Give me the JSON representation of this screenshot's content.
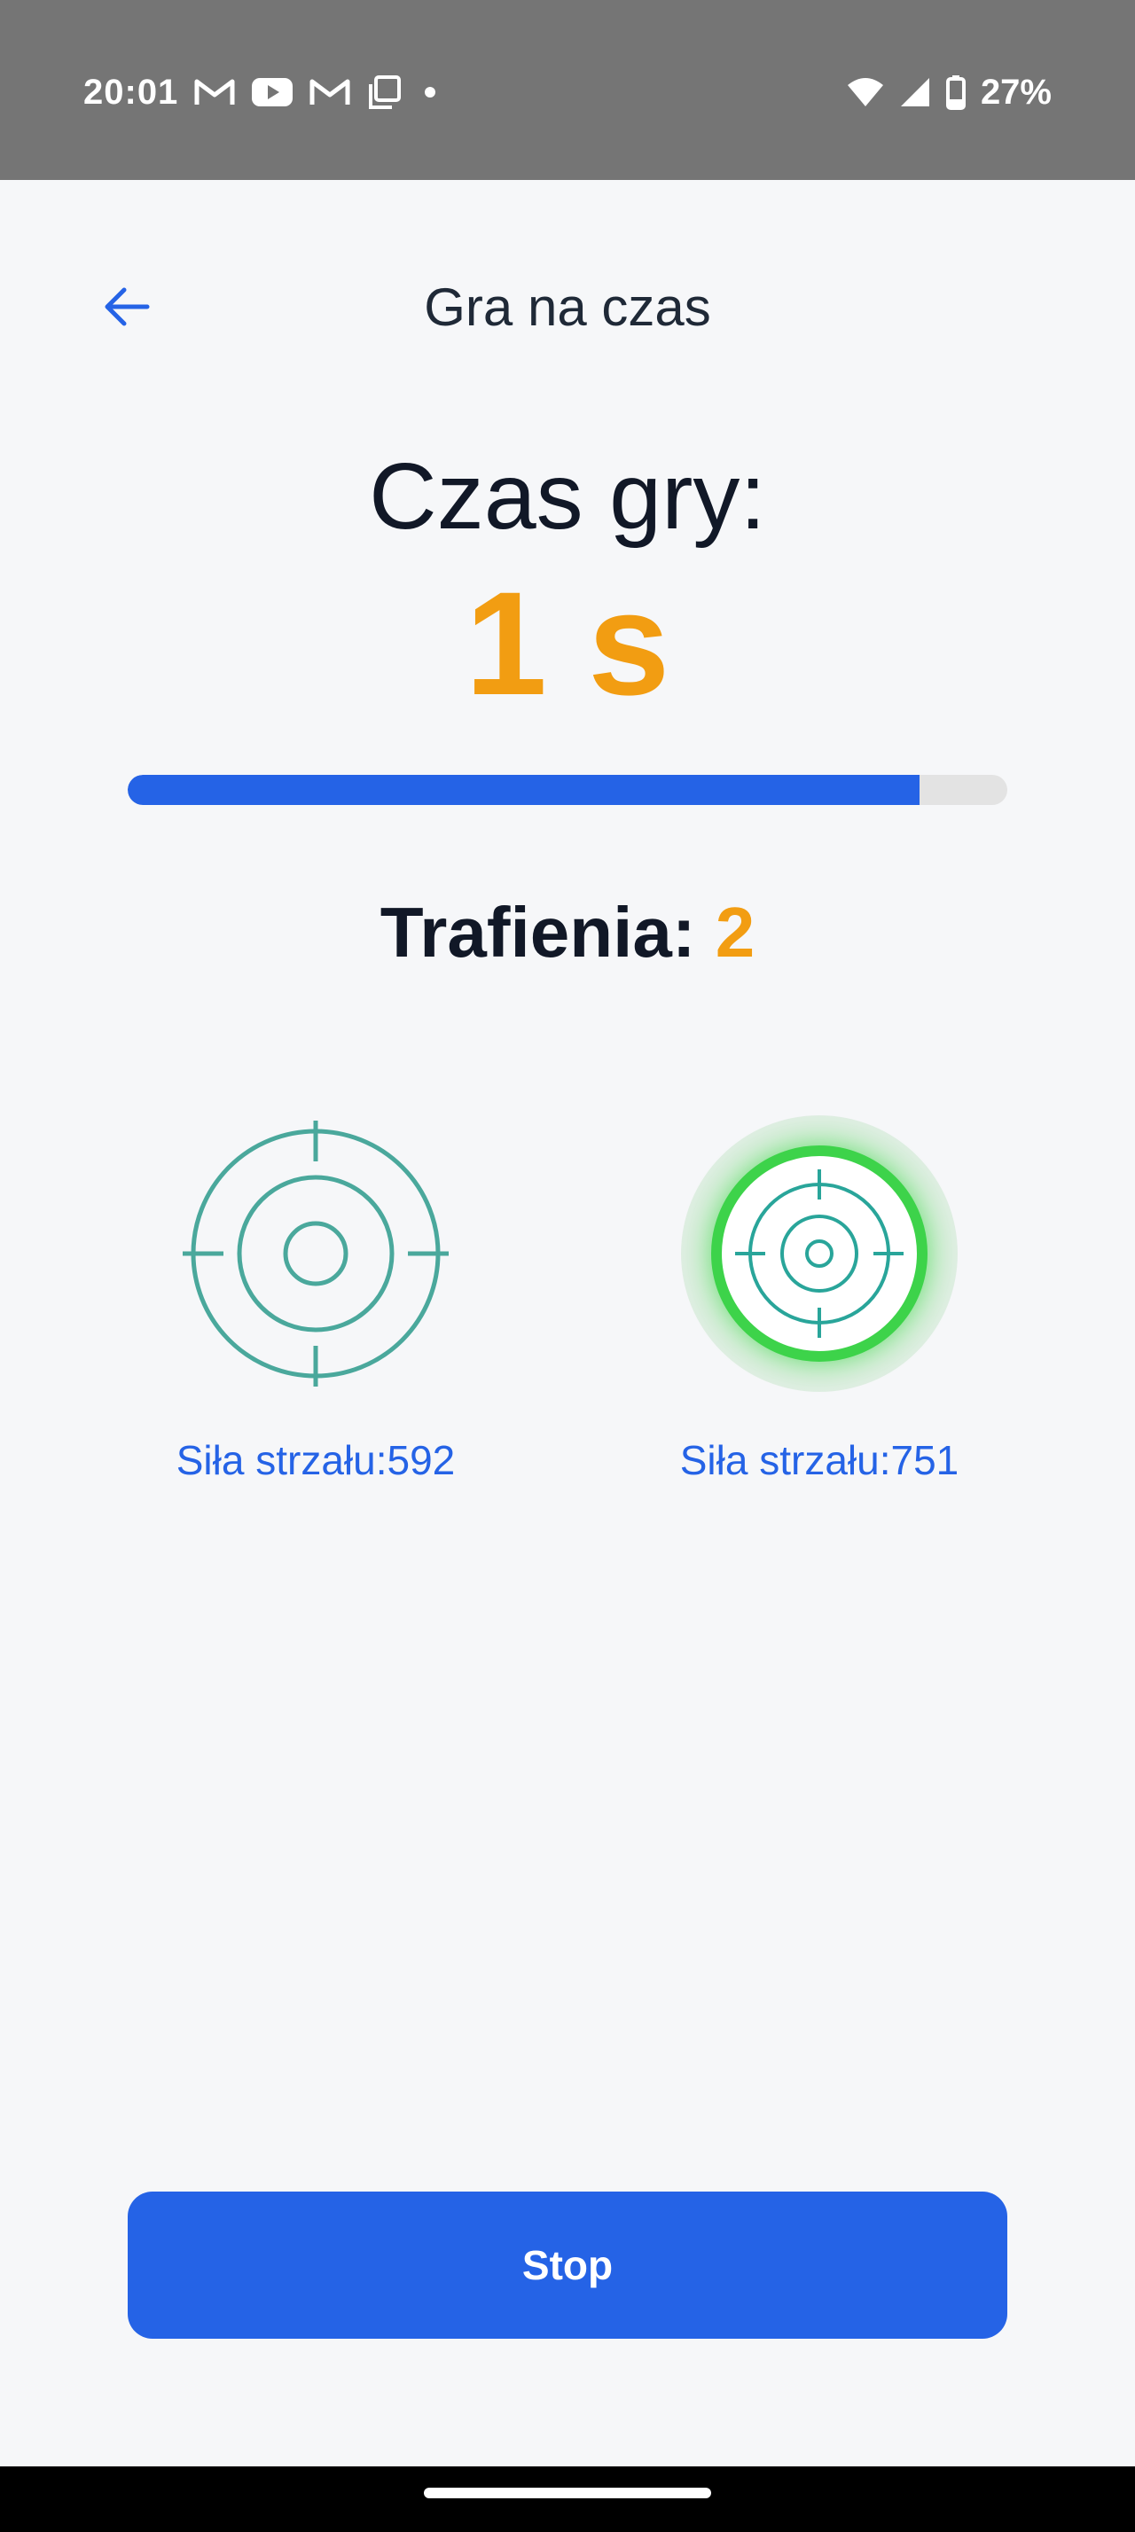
{
  "status_bar": {
    "time": "20:01",
    "battery_percent": "27%",
    "icons": [
      "gmail-icon",
      "youtube-icon",
      "gmail-icon",
      "copy-icon",
      "dot-icon",
      "wifi-icon",
      "signal-icon",
      "battery-icon"
    ]
  },
  "header": {
    "title": "Gra na czas",
    "back_icon": "arrow-left-icon"
  },
  "timer": {
    "label": "Czas gry:",
    "value": "1 s",
    "progress_fraction": 0.9
  },
  "hits": {
    "label": "Trafienia:",
    "count": "2"
  },
  "targets": [
    {
      "icon": "crosshair-icon",
      "shot_power_label": "Siła strzału:592",
      "active": false
    },
    {
      "icon": "crosshair-icon",
      "shot_power_label": "Siła strzału:751",
      "active": true
    }
  ],
  "actions": {
    "stop_label": "Stop"
  },
  "colors": {
    "accent_blue": "#2563e6",
    "accent_orange": "#f29d12",
    "target_teal": "#4aa89c",
    "active_green": "#3dd34a"
  }
}
